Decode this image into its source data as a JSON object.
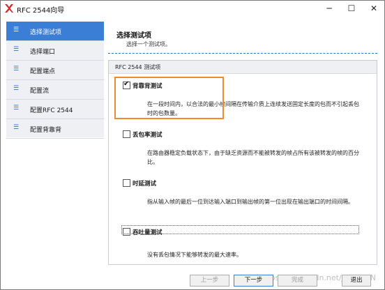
{
  "window": {
    "title": "RFC 2544向导",
    "controls": {
      "minimize": "─",
      "maximize": "☐",
      "close": "✕"
    },
    "logo_icon": "red-x-logo"
  },
  "sidebar": {
    "items": [
      {
        "label": "选择测试项",
        "active": true
      },
      {
        "label": "选择端口",
        "active": false
      },
      {
        "label": "配置端点",
        "active": false
      },
      {
        "label": "配置流",
        "active": false
      },
      {
        "label": "配置RFC 2544",
        "active": false
      },
      {
        "label": "配置背靠背",
        "active": false
      }
    ],
    "item_icon": "menu-lines-icon"
  },
  "header": {
    "title": "选择测试项",
    "subtitle": "选择一个测试项。"
  },
  "group": {
    "title": "RFC 2544 测试项",
    "options": [
      {
        "label": "背靠背测试",
        "checked": true,
        "tick": "✔",
        "desc": "在一段时间内，以合法的最小帧间隔在传输介质上连续发送固定长度的包而不引起丢包时的包数量。"
      },
      {
        "label": "丢包率测试",
        "checked": false,
        "tick": "",
        "desc": "在路由器稳定负载状态下，由于缺乏资源而不能被转发的帧占所有该被转发的帧的百分比。"
      },
      {
        "label": "时延测试",
        "checked": false,
        "tick": "",
        "desc": "指从输入帧的最后一位到达输入端口到输出帧的第一位出现在输出端口的时间间隔。"
      },
      {
        "label": "吞吐量测试",
        "checked": false,
        "tick": "",
        "desc": "没有丢包情况下能够转发的最大速率。"
      }
    ]
  },
  "footer": {
    "prev": "上一步",
    "next": "下一步",
    "finish": "完成",
    "exit": "退出"
  },
  "watermark": "https://blog.csdn.net/JINGWAN",
  "colors": {
    "accent": "#3b7ed6",
    "highlight": "#f08a2a",
    "sidebar_bg": "#eef0f3"
  }
}
